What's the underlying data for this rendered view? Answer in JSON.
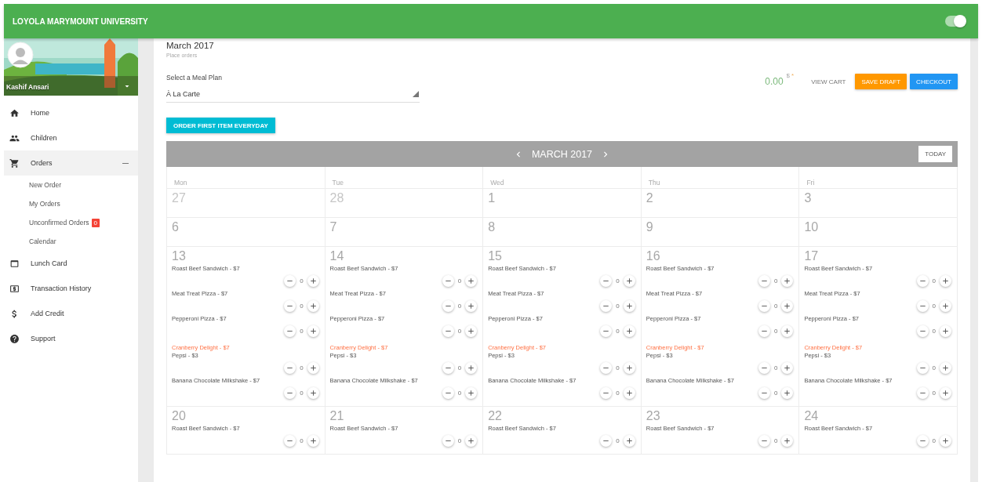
{
  "header": {
    "title": "LOYOLA MARYMOUNT UNIVERSITY",
    "toggle": {
      "on": true
    }
  },
  "sidebar": {
    "user_name": "Kashif Ansari",
    "menu": [
      {
        "label": "Home",
        "selected": false,
        "expanded": false
      },
      {
        "label": "Children",
        "selected": false,
        "expanded": false
      },
      {
        "label": "Orders",
        "selected": true,
        "expanded": true,
        "children": [
          {
            "label": "New Order"
          },
          {
            "label": "My Orders"
          },
          {
            "label": "Unconfirmed Orders",
            "badge": "0"
          },
          {
            "label": "Calendar"
          }
        ]
      },
      {
        "label": "Lunch Card",
        "selected": false,
        "expanded": false
      },
      {
        "label": "Transaction History",
        "selected": false,
        "expanded": false
      },
      {
        "label": "Add Credit",
        "selected": false,
        "expanded": false
      },
      {
        "label": "Support",
        "selected": false,
        "expanded": false
      }
    ]
  },
  "page": {
    "title": "March 2017",
    "subtitle": "Place orders",
    "meal_plan": {
      "label": "Select a Meal Plan",
      "value": "À La Carte"
    },
    "total": "0.00",
    "currency": "$",
    "required_mark": "*",
    "buttons": [
      {
        "label": "VIEW CART",
        "kind": "text"
      },
      {
        "label": "SAVE DRAFT",
        "kind": "draft"
      },
      {
        "label": "CHECKOUT",
        "kind": "primary"
      }
    ],
    "order_first_button": "ORDER FIRST ITEM EVERYDAY"
  },
  "calendar": {
    "month": "MARCH 2017",
    "today_button": "TODAY",
    "weekdays": [
      "Mon",
      "Tue",
      "Wed",
      "Thu",
      "Fri"
    ],
    "weeks": [
      {
        "days": [
          {
            "date": "27",
            "outside_month": true
          },
          {
            "date": "28",
            "outside_month": true
          },
          {
            "date": "1",
            "outside_month": false
          },
          {
            "date": "2",
            "outside_month": false
          },
          {
            "date": "3",
            "outside_month": false
          }
        ]
      },
      {
        "days": [
          {
            "date": "6",
            "outside_month": false
          },
          {
            "date": "7",
            "outside_month": false
          },
          {
            "date": "8",
            "outside_month": false
          },
          {
            "date": "9",
            "outside_month": false
          },
          {
            "date": "10",
            "outside_month": false
          }
        ]
      },
      {
        "days": [
          {
            "date": "13",
            "outside_month": false,
            "items": [
              {
                "name": "Roast Beef Sandwich - $7",
                "kind": "orderable",
                "quantity": "0"
              },
              {
                "name": "Meat Treat Pizza - $7",
                "kind": "orderable",
                "quantity": "0"
              },
              {
                "name": "Pepperoni Pizza - $7",
                "kind": "orderable",
                "quantity": "0"
              },
              {
                "name": "Cranberry Delight - $7",
                "kind": "unavailable"
              },
              {
                "name": "Pepsi - $3",
                "kind": "orderable",
                "quantity": "0"
              },
              {
                "name": "Banana Chocolate Milkshake - $7",
                "kind": "orderable",
                "quantity": "0"
              }
            ]
          },
          {
            "date": "14",
            "outside_month": false,
            "items": [
              {
                "name": "Roast Beef Sandwich - $7",
                "kind": "orderable",
                "quantity": "0"
              },
              {
                "name": "Meat Treat Pizza - $7",
                "kind": "orderable",
                "quantity": "0"
              },
              {
                "name": "Pepperoni Pizza - $7",
                "kind": "orderable",
                "quantity": "0"
              },
              {
                "name": "Cranberry Delight - $7",
                "kind": "unavailable"
              },
              {
                "name": "Pepsi - $3",
                "kind": "orderable",
                "quantity": "0"
              },
              {
                "name": "Banana Chocolate Milkshake - $7",
                "kind": "orderable",
                "quantity": "0"
              }
            ]
          },
          {
            "date": "15",
            "outside_month": false,
            "items": [
              {
                "name": "Roast Beef Sandwich - $7",
                "kind": "orderable",
                "quantity": "0"
              },
              {
                "name": "Meat Treat Pizza - $7",
                "kind": "orderable",
                "quantity": "0"
              },
              {
                "name": "Pepperoni Pizza - $7",
                "kind": "orderable",
                "quantity": "0"
              },
              {
                "name": "Cranberry Delight - $7",
                "kind": "unavailable"
              },
              {
                "name": "Pepsi - $3",
                "kind": "orderable",
                "quantity": "0"
              },
              {
                "name": "Banana Chocolate Milkshake - $7",
                "kind": "orderable",
                "quantity": "0"
              }
            ]
          },
          {
            "date": "16",
            "outside_month": false,
            "items": [
              {
                "name": "Roast Beef Sandwich - $7",
                "kind": "orderable",
                "quantity": "0"
              },
              {
                "name": "Meat Treat Pizza - $7",
                "kind": "orderable",
                "quantity": "0"
              },
              {
                "name": "Pepperoni Pizza - $7",
                "kind": "orderable",
                "quantity": "0"
              },
              {
                "name": "Cranberry Delight - $7",
                "kind": "unavailable"
              },
              {
                "name": "Pepsi - $3",
                "kind": "orderable",
                "quantity": "0"
              },
              {
                "name": "Banana Chocolate Milkshake - $7",
                "kind": "orderable",
                "quantity": "0"
              }
            ]
          },
          {
            "date": "17",
            "outside_month": false,
            "items": [
              {
                "name": "Roast Beef Sandwich - $7",
                "kind": "orderable",
                "quantity": "0"
              },
              {
                "name": "Meat Treat Pizza - $7",
                "kind": "orderable",
                "quantity": "0"
              },
              {
                "name": "Pepperoni Pizza - $7",
                "kind": "orderable",
                "quantity": "0"
              },
              {
                "name": "Cranberry Delight - $7",
                "kind": "unavailable"
              },
              {
                "name": "Pepsi - $3",
                "kind": "orderable",
                "quantity": "0"
              },
              {
                "name": "Banana Chocolate Milkshake - $7",
                "kind": "orderable",
                "quantity": "0"
              }
            ]
          }
        ]
      },
      {
        "days": [
          {
            "date": "20",
            "outside_month": false,
            "items": [
              {
                "name": "Roast Beef Sandwich - $7",
                "kind": "orderable",
                "quantity": "0"
              }
            ]
          },
          {
            "date": "21",
            "outside_month": false,
            "items": [
              {
                "name": "Roast Beef Sandwich - $7",
                "kind": "orderable",
                "quantity": "0"
              }
            ]
          },
          {
            "date": "22",
            "outside_month": false,
            "items": [
              {
                "name": "Roast Beef Sandwich - $7",
                "kind": "orderable",
                "quantity": "0"
              }
            ]
          },
          {
            "date": "23",
            "outside_month": false,
            "items": [
              {
                "name": "Roast Beef Sandwich - $7",
                "kind": "orderable",
                "quantity": "0"
              }
            ]
          },
          {
            "date": "24",
            "outside_month": false,
            "items": [
              {
                "name": "Roast Beef Sandwich - $7",
                "kind": "orderable",
                "quantity": "0"
              }
            ]
          }
        ]
      }
    ]
  }
}
